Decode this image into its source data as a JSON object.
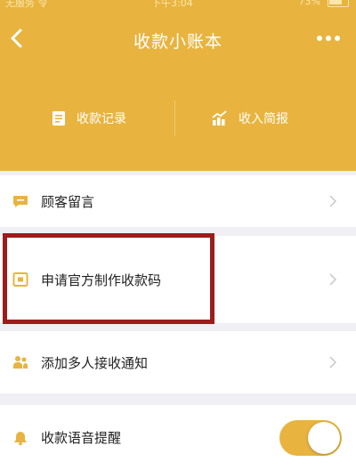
{
  "status_bar": {
    "carrier": "无服务 令",
    "time": "下午3:04",
    "battery": "73%"
  },
  "header": {
    "title": "收款小账本"
  },
  "tabs": [
    {
      "label": "收款记录",
      "icon": "receipt-icon"
    },
    {
      "label": "收入简报",
      "icon": "chart-icon"
    }
  ],
  "menu": [
    {
      "label": "顾客留言",
      "icon": "message-icon"
    },
    {
      "label": "申请官方制作收款码",
      "icon": "qrcode-card-icon"
    },
    {
      "label": "添加多人接收通知",
      "icon": "people-icon"
    },
    {
      "label": "收款语音提醒",
      "icon": "bell-icon"
    }
  ],
  "voice_reminder_enabled": true,
  "colors": {
    "accent": "#e8b43f",
    "highlight_border": "#9c1c1c",
    "background": "#efeff4"
  }
}
